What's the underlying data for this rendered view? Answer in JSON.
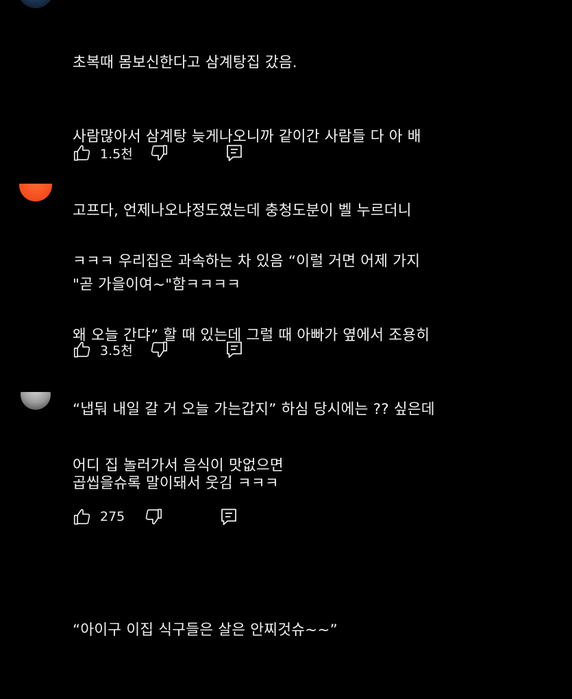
{
  "comments": [
    {
      "lines": [
        "초복때 몸보신한다고 삼계탕집 갔음.",
        "사람많아서 삼계탕 늦게나오니까 같이간 사람들 다 아 배",
        "고프다, 언제나오냐정도였는데 충청도분이 벨 누르더니",
        "\"곧 가을이여~\"함ㅋㅋㅋㅋ"
      ],
      "likes": "1.5천"
    },
    {
      "lines": [
        "ㅋㅋㅋ 우리집은 과속하는 차 있음 “이럴 거면 어제 가지",
        "왜 오늘 간댜” 할 때 있는데 그럴 때 아빠가 옆에서 조용히",
        "“냅둬 내일 갈 거 오늘 가는갑지” 하심 당시에는 ?? 싶은데",
        "곱씹을슈록 말이돼서 웃김 ㅋㅋㅋ"
      ],
      "likes": "3.5천"
    },
    {
      "lines": [
        "어디 집 놀러가서 음식이 맛없으면",
        "",
        "“아이구 이집 식구들은 살은 안찌것슈~~”"
      ],
      "likes": "275"
    }
  ],
  "icons": {
    "like": "thumbs-up-icon",
    "dislike": "thumbs-down-icon",
    "reply": "reply-icon"
  }
}
